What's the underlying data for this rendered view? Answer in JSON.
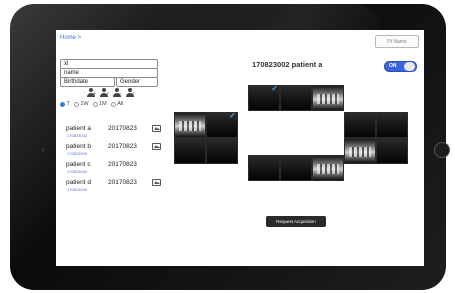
{
  "breadcrumb": "Home >",
  "pt_name_button": "Pt Name",
  "search": {
    "id_value": "xl",
    "name_value": "name",
    "birthdate_value": "Birthdate",
    "gender_value": "Gender"
  },
  "filter": {
    "options": [
      "T",
      "1W",
      "1M",
      "All"
    ],
    "selected": "T"
  },
  "patients": [
    {
      "name": "patient a",
      "id": "170823002",
      "date": "20170823"
    },
    {
      "name": "patient b",
      "id": "170823003",
      "date": "20170823"
    },
    {
      "name": "patient c",
      "id": "170823004",
      "date": "20170823"
    },
    {
      "name": "patient d",
      "id": "170823005",
      "date": "20170823"
    }
  ],
  "header": {
    "patient_title": "170823002 patient a",
    "toggle_label": "ON"
  },
  "request_button": "Request Acquisition",
  "colors": {
    "accent": "#3b66d9",
    "check": "#3aa3ff",
    "tile_dark": "#141414"
  },
  "icons": [
    "user-add-icon",
    "user-check-icon",
    "user-remove-icon",
    "user-search-icon",
    "image-icon",
    "check-icon"
  ]
}
